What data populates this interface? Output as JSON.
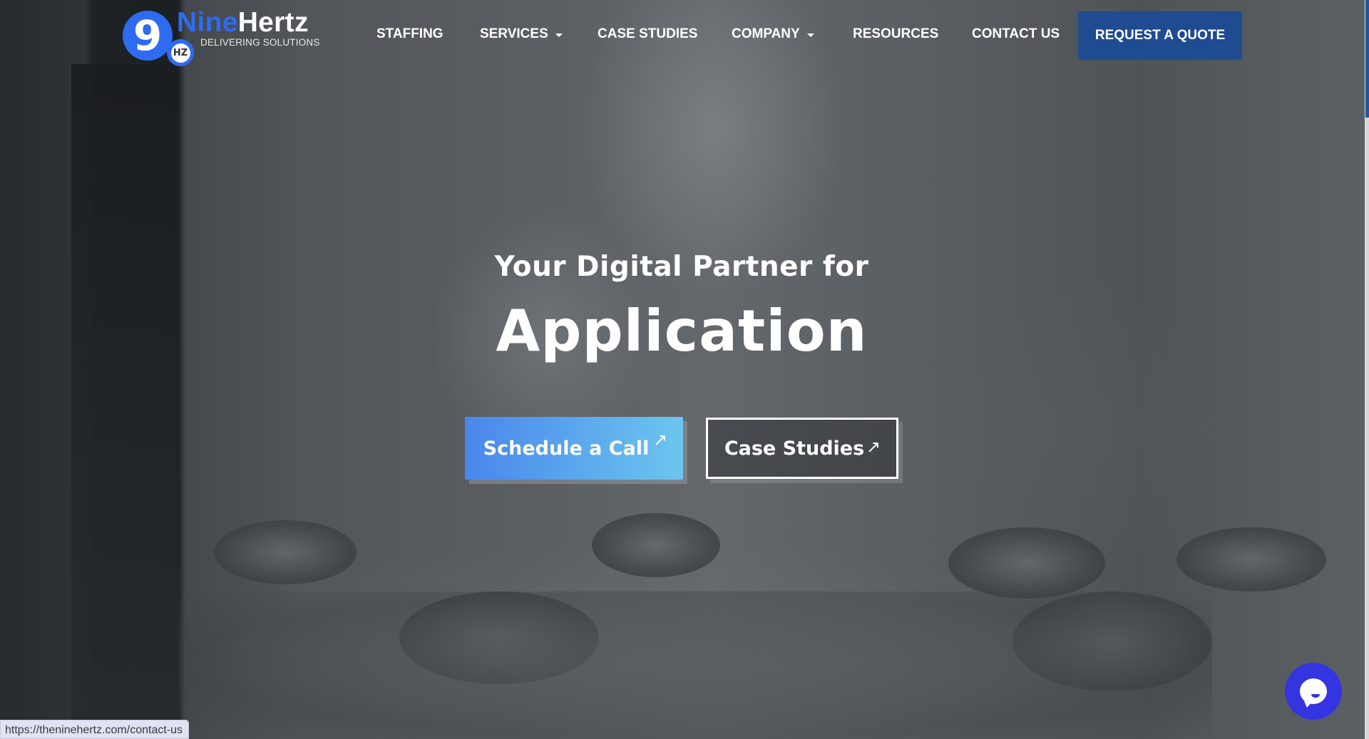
{
  "brand": {
    "logo_glyph": "9",
    "logo_badge": "HZ",
    "name_part1": "Nine",
    "name_part2": "Hertz",
    "tagline": "DELIVERING SOLUTIONS",
    "accent_color": "#2f6bf0"
  },
  "nav": {
    "items": [
      {
        "label": "STAFFING",
        "has_dropdown": false
      },
      {
        "label": "SERVICES",
        "has_dropdown": true
      },
      {
        "label": "CASE STUDIES",
        "has_dropdown": false
      },
      {
        "label": "COMPANY",
        "has_dropdown": true
      },
      {
        "label": "RESOURCES",
        "has_dropdown": false
      },
      {
        "label": "CONTACT US",
        "has_dropdown": false
      }
    ],
    "cta_label": "REQUEST A QUOTE",
    "cta_color": "#1f4b91"
  },
  "hero": {
    "subtitle": "Your Digital Partner for",
    "title": "Application",
    "primary_cta": {
      "label": "Schedule a Call",
      "icon": "arrow-up-right-icon",
      "glyph": "↗"
    },
    "secondary_cta": {
      "label": "Case Studies",
      "icon": "arrow-up-right-icon",
      "glyph": "↗"
    }
  },
  "chat_widget": {
    "icon": "chat-bubble-icon",
    "color": "#3434e0"
  },
  "status_bar": {
    "url": "https://theninehertz.com/contact-us"
  }
}
